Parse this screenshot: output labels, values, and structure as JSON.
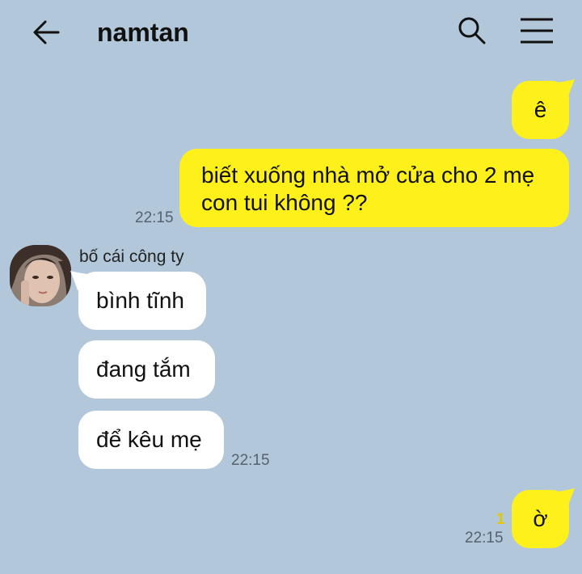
{
  "header": {
    "title": "namtan"
  },
  "icons": {
    "back": "arrow-left-icon",
    "search": "search-icon",
    "menu": "hamburger-menu-icon"
  },
  "colors": {
    "background": "#b2c7d9",
    "my_bubble": "#fef01b",
    "their_bubble": "#ffffff",
    "unread": "#e3c800"
  },
  "messages": {
    "m1": {
      "text": "ê"
    },
    "m2": {
      "line1": "biết xuống nhà mở cửa cho 2 mẹ",
      "line2": "con tui không ??",
      "time": "22:15"
    },
    "sender": {
      "name": "bố cái công ty"
    },
    "m3": {
      "text": "bình tĩnh"
    },
    "m4": {
      "text": "đang tắm"
    },
    "m5": {
      "text": "để kêu mẹ",
      "time": "22:15"
    },
    "m6": {
      "text": "ờ",
      "time": "22:15",
      "unread": "1"
    }
  }
}
